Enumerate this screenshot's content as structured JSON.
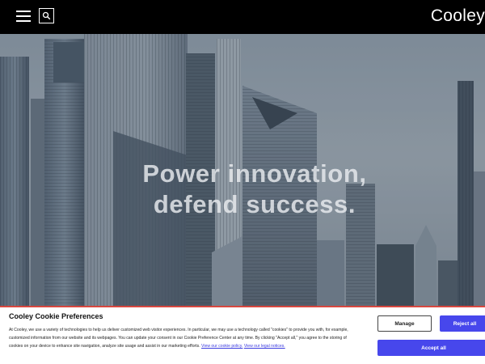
{
  "header": {
    "brand": "Cooley",
    "menu_icon": "hamburger-menu-icon",
    "search_icon": "search-icon"
  },
  "hero": {
    "line1": "Power innovation,",
    "line2": "defend success."
  },
  "cookie_banner": {
    "title": "Cooley Cookie Preferences",
    "body": "At Cooley, we use a variety of technologies to help us deliver customized web visitor experiences. In particular, we may use a technology called \"cookies\" to provide you with, for example, customized information from our website and its webpages. You can update your consent in our Cookie Preference Center at any time. By clicking \"Accept all,\" you agree to the storing of cookies on your device to enhance site navigation, analyze site usage and assist in our marketing efforts.",
    "cookie_policy_link": "View our cookie policy.",
    "legal_notices_link": "View our legal notices.",
    "manage_label": "Manage",
    "reject_label": "Reject all",
    "accept_label": "Accept all"
  },
  "colors": {
    "accent": "#4747ec",
    "banner_border": "#d9473f",
    "header_bg": "#000000"
  }
}
